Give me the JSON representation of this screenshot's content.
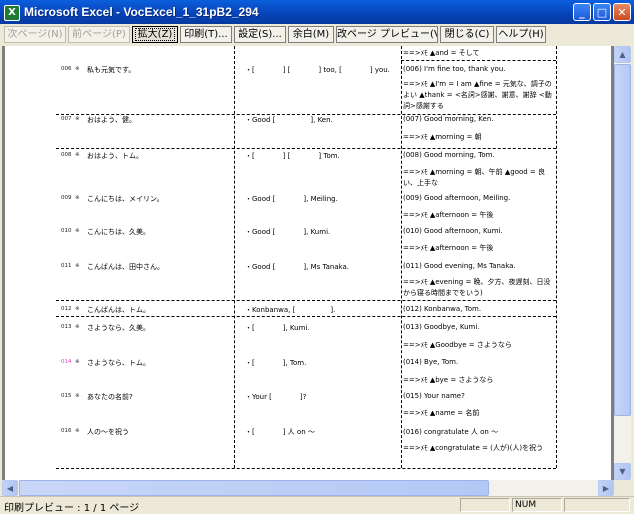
{
  "window": {
    "title": "Microsoft Excel - VocExcel_1_31pB2_294",
    "app_icon_glyph": "X",
    "minimize_glyph": "_",
    "maximize_glyph": "□",
    "close_glyph": "✕"
  },
  "toolbar": {
    "next_page": "次ページ(N)",
    "prev_page": "前ページ(P)",
    "zoom": "拡大(Z)",
    "print": "印刷(T)...",
    "setup": "設定(S)...",
    "margins": "余白(M)",
    "page_break_preview": "改ページ プレビュー(V)",
    "close": "閉じる(C)",
    "help": "ヘルプ(H)"
  },
  "sheet": {
    "top_memo": "==>ﾒﾓ ▲and = そして",
    "rows": [
      {
        "num": "006",
        "mark": "※",
        "jp": "私も元気です。",
        "fill": "・[　　　　] [　　　　] too, [　　　　] you.",
        "en": "(006) I'm fine too, thank you.",
        "memo": "==>ﾒﾓ ▲I'm = I am ▲fine = 元気な、調子のよい ▲thank = <名詞>感謝、謝意、謝辞 <動詞>感謝する"
      },
      {
        "num": "007",
        "mark": "※",
        "jp": "おはよう、健。",
        "fill": "・Good [　　　　　], Ken.",
        "en": "(007) Good morning, Ken.",
        "memo": "==>ﾒﾓ ▲morning = 朝"
      },
      {
        "num": "008",
        "mark": "※",
        "jp": "おはよう、トム。",
        "fill": "・[　　　　] [　　　　] Tom.",
        "en": "(008) Good morning, Tom.",
        "memo": "==>ﾒﾓ ▲morning = 朝、午前 ▲good = 良い、上手な"
      },
      {
        "num": "009",
        "mark": "※",
        "jp": "こんにちは、メイリン。",
        "fill": "・Good [　　　　], Meiling.",
        "en": "(009) Good afternoon, Meiling.",
        "memo": "==>ﾒﾓ ▲afternoon = 午後"
      },
      {
        "num": "010",
        "mark": "※",
        "jp": "こんにちは、久美。",
        "fill": "・Good [　　　　], Kumi.",
        "en": "(010) Good afternoon, Kumi.",
        "memo": "==>ﾒﾓ ▲afternoon = 午後"
      },
      {
        "num": "011",
        "mark": "※",
        "jp": "こんばんは、田中さん。",
        "fill": "・Good [　　　　], Ms Tanaka.",
        "en": "(011) Good evening, Ms Tanaka.",
        "memo": "==>ﾒﾓ ▲evening = 晩、夕方、夜遅刻、日没から寝る時間までをいう)"
      },
      {
        "num": "012",
        "mark": "※",
        "jp": "こんばんは、トム。",
        "fill": "・Konbanwa, [　　　　　].",
        "en": "(012) Konbanwa, Tom.",
        "memo": ""
      },
      {
        "num": "013",
        "mark": "※",
        "jp": "さようなら、久美。",
        "fill": "・[　　　　], Kumi.",
        "en": "(013) Goodbye, Kumi.",
        "memo": "==>ﾒﾓ ▲Goodbye = さようなら"
      },
      {
        "num": "014",
        "mark": "※",
        "jp": "さようなら、トム。",
        "fill": "・[　　　　], Tom.",
        "en": "(014) Bye, Tom.",
        "memo": "==>ﾒﾓ ▲bye = さようなら"
      },
      {
        "num": "015",
        "mark": "※",
        "jp": "あなたの名前?",
        "fill": "・Your [　　　　]?",
        "en": "(015) Your name?",
        "memo": "==>ﾒﾓ ▲name = 名前"
      },
      {
        "num": "016",
        "mark": "※",
        "jp": "人の～を祝う",
        "fill": "・[　　　　] 人 on ～",
        "en": "(016) congratulate 人 on ～",
        "memo": "==>ﾒﾓ ▲congratulate = (人が)(人)を祝う"
      }
    ]
  },
  "statusbar": {
    "text": "印刷プレビュー : 1 / 1 ページ",
    "num_indicator": "NUM"
  },
  "colors": {
    "titlebar": "#0842b8",
    "highlight_row_number": "#e040c0"
  },
  "icons": {
    "scroll_up": "▲",
    "scroll_down": "▼",
    "scroll_left": "◀",
    "scroll_right": "▶"
  }
}
